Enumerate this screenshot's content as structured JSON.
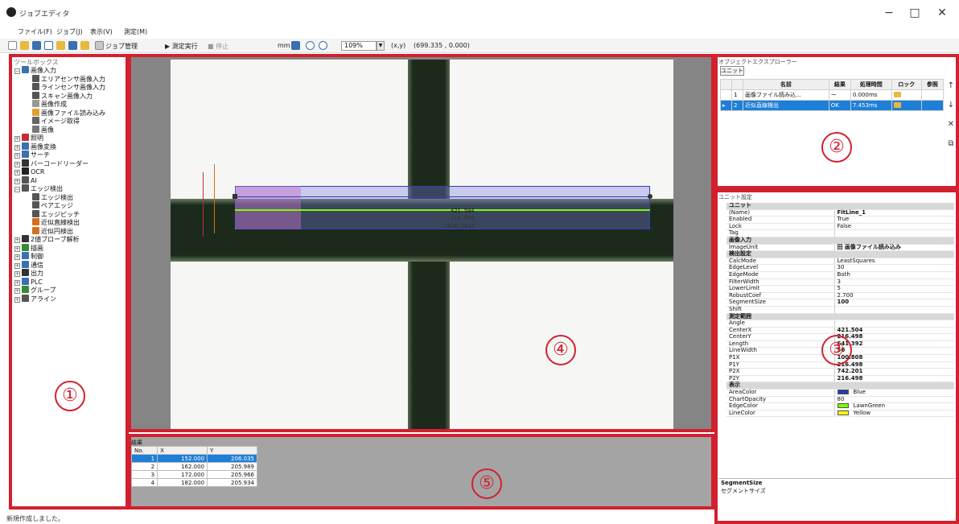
{
  "window": {
    "title": "ジョブエディタ",
    "controls": [
      "−",
      "□",
      "✕"
    ]
  },
  "menu": [
    "ファイル(F)",
    "ジョブ(J)",
    "表示(V)",
    "測定(M)"
  ],
  "toolbar": {
    "job_manage": "ジョブ管理",
    "run_measure": "▶ 測定実行",
    "stop": "■ 停止",
    "unit_label": "mm",
    "zoom": "109%",
    "coord_label": "(x,y)",
    "coord_value": "(699.335 , 0.000)"
  },
  "left_panel": {
    "header": "ツールボックス",
    "tree": [
      {
        "label": "画像入力",
        "level": 0,
        "expanded": true,
        "color": "#3a6fb0"
      },
      {
        "label": "エリアセンサ画像入力",
        "level": 1,
        "color": "#555"
      },
      {
        "label": "ラインセンサ画像入力",
        "level": 1,
        "color": "#555"
      },
      {
        "label": "スキャン画像入力",
        "level": 1,
        "color": "#555"
      },
      {
        "label": "画像作成",
        "level": 1,
        "color": "#999"
      },
      {
        "label": "画像ファイル読み込み",
        "level": 1,
        "color": "#e0a030"
      },
      {
        "label": "イメージ取得",
        "level": 1,
        "color": "#666"
      },
      {
        "label": "画像",
        "level": 1,
        "color": "#777"
      },
      {
        "label": "照明",
        "level": 0,
        "color": "#c03030"
      },
      {
        "label": "画像変換",
        "level": 0,
        "color": "#3a6fb0"
      },
      {
        "label": "サーチ",
        "level": 0,
        "color": "#3a6fb0"
      },
      {
        "label": "バーコードリーダー",
        "level": 0,
        "color": "#333"
      },
      {
        "label": "OCR",
        "level": 0,
        "color": "#222"
      },
      {
        "label": "AI",
        "level": 0,
        "color": "#555"
      },
      {
        "label": "エッジ検出",
        "level": 0,
        "expanded": true,
        "color": "#555"
      },
      {
        "label": "エッジ検出",
        "level": 1,
        "color": "#555"
      },
      {
        "label": "ペアエッジ",
        "level": 1,
        "color": "#555"
      },
      {
        "label": "エッジピッチ",
        "level": 1,
        "color": "#555"
      },
      {
        "label": "近似直線検出",
        "level": 1,
        "color": "#d07020"
      },
      {
        "label": "近似円検出",
        "level": 1,
        "color": "#d07020"
      },
      {
        "label": "2値ブローブ解析",
        "level": 0,
        "color": "#333"
      },
      {
        "label": "描画",
        "level": 0,
        "color": "#3a8a3a"
      },
      {
        "label": "制御",
        "level": 0,
        "color": "#3a6fb0"
      },
      {
        "label": "通信",
        "level": 0,
        "color": "#3a6fb0"
      },
      {
        "label": "出力",
        "level": 0,
        "color": "#333"
      },
      {
        "label": "PLC",
        "level": 0,
        "color": "#3a6fb0"
      },
      {
        "label": "グループ",
        "level": 0,
        "color": "#3a8a3a"
      },
      {
        "label": "アライン",
        "level": 0,
        "color": "#555"
      }
    ]
  },
  "canvas": {
    "overlay": {
      "value1": "421.504",
      "value2": "216.498",
      "value3": "2016,2014"
    }
  },
  "results": {
    "title": "結果",
    "columns": [
      "No.",
      "X",
      "Y"
    ],
    "rows": [
      {
        "no": "1",
        "x": "152.000",
        "y": "206.035",
        "selected": true
      },
      {
        "no": "2",
        "x": "162.000",
        "y": "205.989"
      },
      {
        "no": "3",
        "x": "172.000",
        "y": "205.966"
      },
      {
        "no": "4",
        "x": "182.000",
        "y": "205.934"
      }
    ]
  },
  "unit_explorer": {
    "header": "オブジェクトエクスプローラー",
    "tab": "ユニット",
    "columns": [
      "名前",
      "結果",
      "処理時間",
      "ロック",
      "参照"
    ],
    "rows": [
      {
        "no": "1",
        "name": "画像ファイル読み込...",
        "result": "ー",
        "time": "0.000ms"
      },
      {
        "no": "2",
        "name": "近似直線検出",
        "result": "OK",
        "time": "7.453ms",
        "selected": true
      }
    ],
    "side_buttons": [
      "↑",
      "↓",
      "✕",
      "⧉"
    ]
  },
  "properties": {
    "header": "ユニット設定",
    "rows": [
      {
        "cat": "ユニット"
      },
      {
        "k": "(Name)",
        "v": "FitLine_1",
        "bold": true
      },
      {
        "k": "Enabled",
        "v": "True"
      },
      {
        "k": "Lock",
        "v": "False"
      },
      {
        "k": "Tag",
        "v": ""
      },
      {
        "cat": "画像入力"
      },
      {
        "k": "ImageUnit",
        "v": "田 画像ファイル読み込み",
        "bold": true
      },
      {
        "cat": "検出設定"
      },
      {
        "k": "CalcMode",
        "v": "LeastSquares"
      },
      {
        "k": "EdgeLevel",
        "v": "30"
      },
      {
        "k": "EdgeMode",
        "v": "Both"
      },
      {
        "k": "FilterWidth",
        "v": "3"
      },
      {
        "k": "LowerLimit",
        "v": "5"
      },
      {
        "k": "RobustCoef",
        "v": "2.700"
      },
      {
        "k": "SegmentSize",
        "v": "100",
        "bold": true
      },
      {
        "k": "Shift",
        "v": ""
      },
      {
        "cat": "測定範囲"
      },
      {
        "k": "Angle",
        "v": ""
      },
      {
        "k": "CenterX",
        "v": "421.504",
        "bold": true
      },
      {
        "k": "CenterY",
        "v": "216.498",
        "bold": true
      },
      {
        "k": "Length",
        "v": "641.392",
        "bold": true
      },
      {
        "k": "LineWidth",
        "v": "50",
        "bold": true
      },
      {
        "k": "P1X",
        "v": "100.808",
        "bold": true
      },
      {
        "k": "P1Y",
        "v": "216.498",
        "bold": true
      },
      {
        "k": "P2X",
        "v": "742.201",
        "bold": true
      },
      {
        "k": "P2Y",
        "v": "216.498",
        "bold": true
      },
      {
        "cat": "表示"
      },
      {
        "k": "AreaColor",
        "v": "Blue",
        "swatch": "#1f3fae"
      },
      {
        "k": "ChartOpacity",
        "v": "80"
      },
      {
        "k": "EdgeColor",
        "v": "LawnGreen",
        "swatch": "#7cfc00"
      },
      {
        "k": "LineColor",
        "v": "Yellow",
        "swatch": "#ffff00"
      }
    ],
    "desc_name": "SegmentSize",
    "desc_text": "セグメントサイズ"
  },
  "status": {
    "text": "新規作成しました。"
  },
  "callouts": [
    "①",
    "②",
    "③",
    "④",
    "⑤"
  ]
}
